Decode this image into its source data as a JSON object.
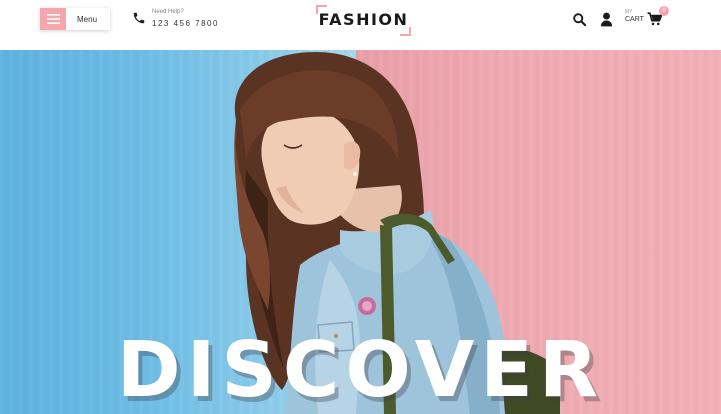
{
  "header": {
    "menu_label": "Menu",
    "help_label": "Need Help?",
    "help_number": "123  456  7800",
    "logo": "FASHION",
    "cart_small": "MY",
    "cart_label": "CART",
    "cart_count": "0",
    "icons": [
      "hamburger-icon",
      "phone-icon",
      "search-icon",
      "user-icon",
      "cart-icon"
    ]
  },
  "hero": {
    "title": "DISCOVER",
    "background_left": "#6cbde6",
    "background_right": "#f0aab1"
  },
  "colors": {
    "accent": "#f4a6ac",
    "text_dark": "#1a1a1a"
  }
}
